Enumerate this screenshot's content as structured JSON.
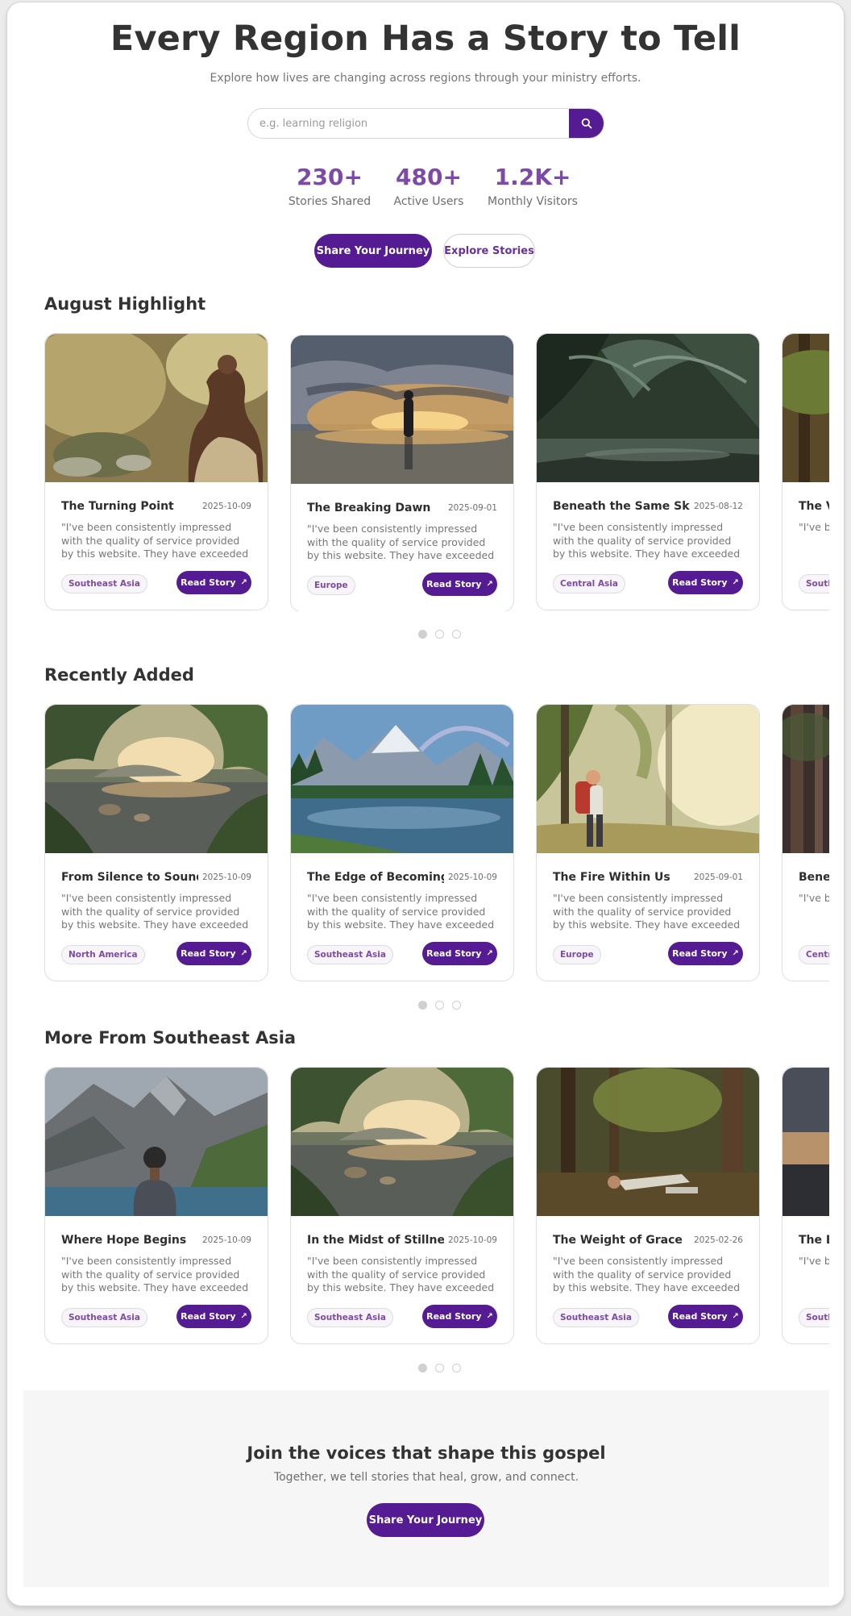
{
  "hero": {
    "title": "Every Region Has a Story to Tell",
    "subtitle": "Explore how lives are changing across regions through your ministry efforts.",
    "search_placeholder": "e.g. learning religion",
    "search_icon": "search-icon",
    "stats": [
      {
        "number": "230+",
        "label": "Stories Shared"
      },
      {
        "number": "480+",
        "label": "Active Users"
      },
      {
        "number": "1.2K+",
        "label": "Monthly Visitors"
      }
    ],
    "primary_button": "Share Your Journey",
    "secondary_button": "Explore Stories"
  },
  "colors": {
    "brand": "#541b93",
    "accent": "#7d4aa8"
  },
  "read_story_label": "Read Story",
  "arrow_icon": "arrow-up-right-icon",
  "sections": [
    {
      "title": "August Highlight",
      "active_dot": 0,
      "cards": [
        {
          "title": "The Turning Point",
          "date": "2025-10-09",
          "excerpt": "\"I've been consistently impressed with the quality of service provided by this website. They have exceeded my exp...",
          "region": "Southeast Asia",
          "image": "woman-in-garden-photo"
        },
        {
          "title": "The Breaking Dawn",
          "date": "2025-09-01",
          "excerpt": "\"I've been consistently impressed with the quality of service provided by this website. They have exceeded my exp...",
          "region": "Europe",
          "image": "man-at-sunrise-lake-photo"
        },
        {
          "title": "Beneath the Same Sky",
          "date": "2025-08-12",
          "excerpt": "\"I've been consistently impressed with the quality of service provided by this website. They have exceeded my exp...",
          "region": "Central Asia",
          "image": "jungle-river-photo"
        },
        {
          "title": "The V",
          "date": "",
          "excerpt": "\"I've b the q webs",
          "region": "South",
          "image": "forest-photo"
        }
      ]
    },
    {
      "title": "Recently Added",
      "active_dot": 0,
      "cards": [
        {
          "title": "From Silence to Sound",
          "date": "2025-10-09",
          "excerpt": "\"I've been consistently impressed with the quality of service provided by this website. They have exceeded my exp...",
          "region": "North America",
          "image": "lake-at-sunset-photo"
        },
        {
          "title": "The Edge of Becoming",
          "date": "2025-10-09",
          "excerpt": "\"I've been consistently impressed with the quality of service provided by this website. They have exceeded my exp...",
          "region": "Southeast Asia",
          "image": "mountain-lake-rainbow-photo"
        },
        {
          "title": "The Fire Within Us",
          "date": "2025-09-01",
          "excerpt": "\"I've been consistently impressed with the quality of service provided by this website. They have exceeded my exp...",
          "region": "Europe",
          "image": "hiker-in-sunlit-forest-photo"
        },
        {
          "title": "Bene",
          "date": "",
          "excerpt": "\"I've b the q webs",
          "region": "Centr",
          "image": "forest-trunks-photo"
        }
      ]
    },
    {
      "title": "More From Southeast Asia",
      "active_dot": 0,
      "cards": [
        {
          "title": "Where Hope Begins",
          "date": "2025-10-09",
          "excerpt": "\"I've been consistently impressed with the quality of service provided by this website. They have exceeded my exp...",
          "region": "Southeast Asia",
          "image": "man-facing-mountain-photo"
        },
        {
          "title": "In the Midst of Stillness",
          "date": "2025-10-09",
          "excerpt": "\"I've been consistently impressed with the quality of service provided by this website. They have exceeded my exp...",
          "region": "Southeast Asia",
          "image": "lake-at-sunset-photo"
        },
        {
          "title": "The Weight of Grace",
          "date": "2025-02-26",
          "excerpt": "\"I've been consistently impressed with the quality of service provided by this website. They have exceeded my exp...",
          "region": "Southeast Asia",
          "image": "person-resting-in-woods-photo"
        },
        {
          "title": "The E",
          "date": "",
          "excerpt": "\"I've b the q webs",
          "region": "South",
          "image": "dusk-sky-photo"
        }
      ]
    }
  ],
  "footer": {
    "title": "Join the voices that shape this gospel",
    "subtitle": "Together, we tell stories that heal, grow, and connect.",
    "button": "Share Your Journey"
  }
}
